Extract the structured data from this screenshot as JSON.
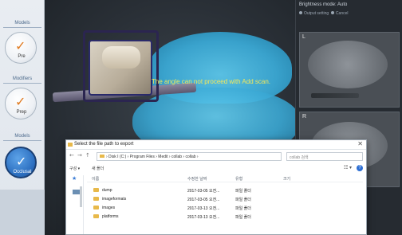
{
  "sidebar": {
    "section1": "Models",
    "section2": "Modifiers",
    "section3": "Models",
    "step1_label": "Pre",
    "step2_label": "Prep",
    "step3_label": "Occlusal",
    "check_glyph": "✓"
  },
  "viewport": {
    "warning": "The angle can not proceed with Add scan."
  },
  "right_panel": {
    "title": "Brightness mode: Auto",
    "option1": "Output setting",
    "option2": "Cancel",
    "cam1_tag": "L",
    "cam2_tag": "R"
  },
  "dialog": {
    "title": "Select the file path to export",
    "close_glyph": "✕",
    "nav_back": "←",
    "nav_forward": "→",
    "nav_up": "↑",
    "path": "› Disk I (C:) › Program Files › Medit › collab › collab ›",
    "search_placeholder": "collab 검색",
    "organize": "구성 ▾",
    "new_folder": "새 폴더",
    "view_glyph": "☷ ▾",
    "help_glyph": "?",
    "columns": {
      "name": "이름",
      "date": "수정한 날짜",
      "type": "유형",
      "size": "크기"
    },
    "files": [
      {
        "name": "dump",
        "date": "2017-03-05 오전...",
        "type": "파일 폴더"
      },
      {
        "name": "imageformats",
        "date": "2017-03-05 오전...",
        "type": "파일 폴더"
      },
      {
        "name": "images",
        "date": "2017-03-13 오전...",
        "type": "파일 폴더"
      },
      {
        "name": "platforms",
        "date": "2017-03-13 오전...",
        "type": "파일 폴더"
      }
    ]
  },
  "colors": {
    "accent_blue": "#2c6fc0",
    "check_orange": "#e07a1f",
    "warning_yellow": "#f4e85a",
    "scan_blue": "#3aa8d4"
  }
}
